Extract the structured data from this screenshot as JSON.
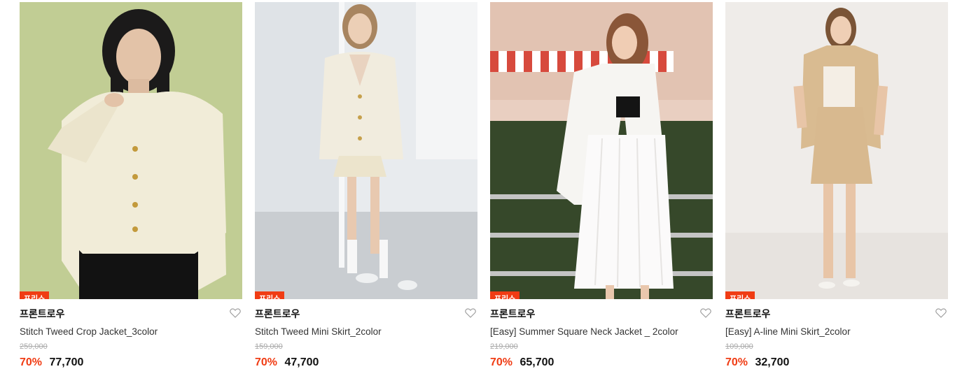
{
  "products": [
    {
      "badge": "프리쇼",
      "brand": "프론트로우",
      "name": "Stitch Tweed Crop Jacket_3color",
      "original_price": "259,000",
      "discount": "70%",
      "price": "77,700",
      "wishlist_icon": "heart-outline-icon"
    },
    {
      "badge": "프리쇼",
      "brand": "프론트로우",
      "name": "Stitch Tweed Mini Skirt_2color",
      "original_price": "159,000",
      "discount": "70%",
      "price": "47,700",
      "wishlist_icon": "heart-outline-icon"
    },
    {
      "badge": "프리쇼",
      "brand": "프론트로우",
      "name": "[Easy] Summer Square Neck Jacket _ 2color",
      "original_price": "219,000",
      "discount": "70%",
      "price": "65,700",
      "wishlist_icon": "heart-outline-icon"
    },
    {
      "badge": "프리쇼",
      "brand": "프론트로우",
      "name": "[Easy] A-line Mini Skirt_2color",
      "original_price": "109,000",
      "discount": "70%",
      "price": "32,700",
      "wishlist_icon": "heart-outline-icon"
    }
  ],
  "colors": {
    "accent": "#f03c14",
    "strike_price": "#aaaaaa"
  }
}
